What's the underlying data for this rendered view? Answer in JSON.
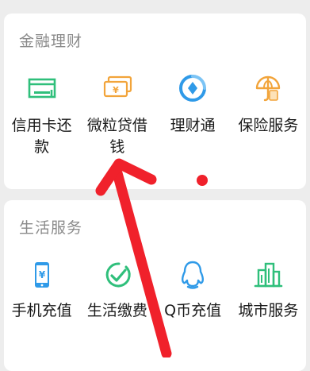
{
  "finance": {
    "title": "金融理财",
    "items": [
      {
        "label": "信用卡还款",
        "icon": "credit-card-icon",
        "color": "#2fbf7b"
      },
      {
        "label": "微粒贷借钱",
        "icon": "banknote-icon",
        "color": "#f2a43a"
      },
      {
        "label": "理财通",
        "icon": "wealth-icon",
        "color": "#2f9ae8"
      },
      {
        "label": "保险服务",
        "icon": "umbrella-icon",
        "color": "#f2a43a"
      }
    ]
  },
  "life": {
    "title": "生活服务",
    "items": [
      {
        "label": "手机充值",
        "icon": "phone-recharge-icon",
        "color": "#2f9ae8"
      },
      {
        "label": "生活缴费",
        "icon": "checkmark-circle-icon",
        "color": "#2fbf7b"
      },
      {
        "label": "Q币充值",
        "icon": "penguin-icon",
        "color": "#2f9ae8"
      },
      {
        "label": "城市服务",
        "icon": "city-buildings-icon",
        "color": "#2fbf7b"
      }
    ]
  },
  "annotation": {
    "color": "#f0212b"
  }
}
